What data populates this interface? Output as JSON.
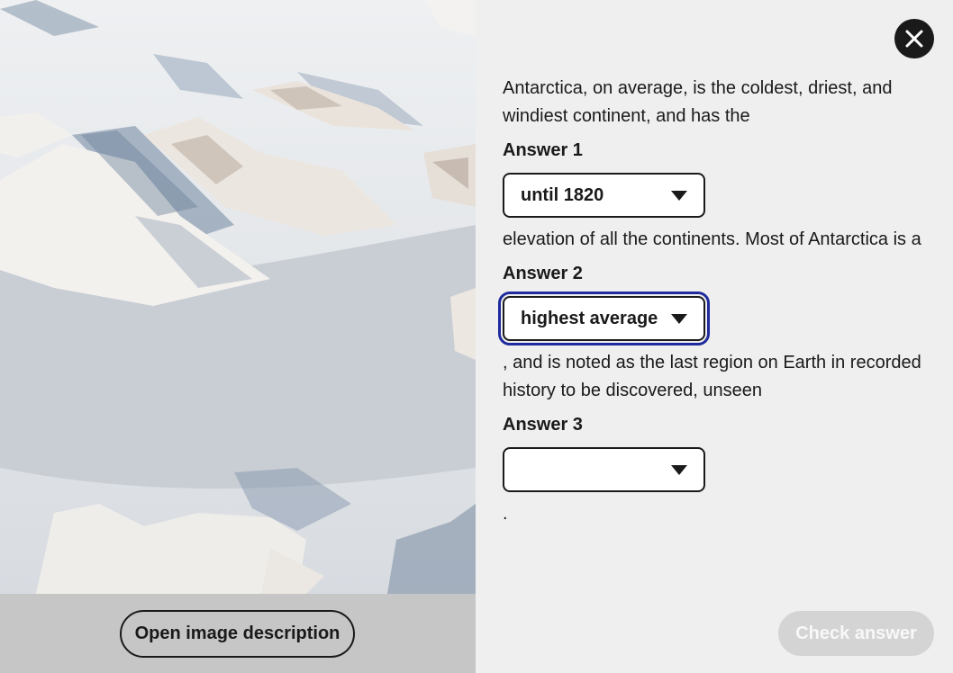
{
  "image_panel": {
    "description_button_label": "Open image description"
  },
  "question": {
    "text_1": "Antarctica, on average, is the coldest, driest, and windiest continent, and has the",
    "answer_1_label": "Answer 1",
    "answer_1_value": "until 1820",
    "text_2": "elevation of all the continents. Most of Antarctica is a",
    "answer_2_label": "Answer 2",
    "answer_2_value": "highest average",
    "text_3": ", and is noted as the last region on Earth in recorded history to be discovered, unseen",
    "answer_3_label": "Answer 3",
    "answer_3_value": "",
    "text_4": "."
  },
  "actions": {
    "check_label": "Check answer",
    "close_icon": "close-icon"
  },
  "colors": {
    "focus_outline": "#1f2a9c",
    "button_disabled_bg": "#d4d4d4",
    "panel_bg": "#efefef"
  }
}
